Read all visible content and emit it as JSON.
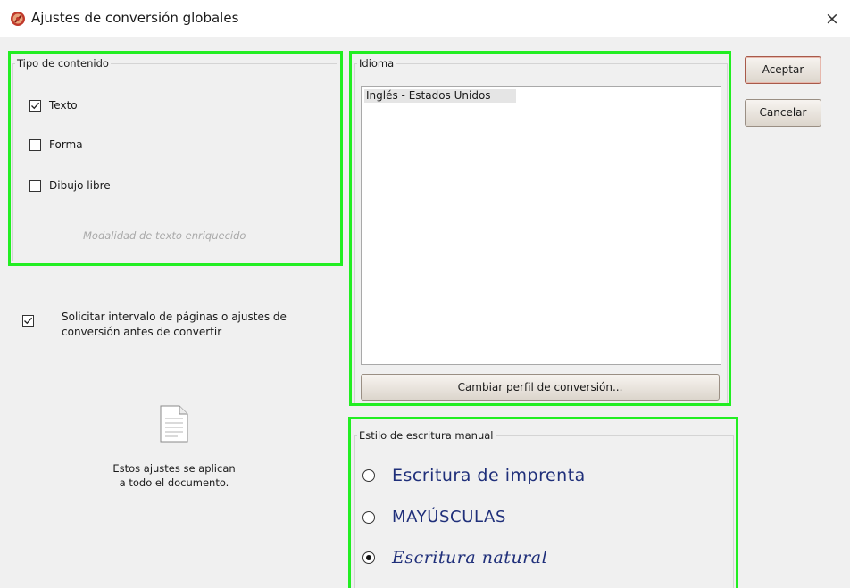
{
  "window": {
    "title": "Ajustes de conversión globales",
    "close_symbol": "×"
  },
  "content_type": {
    "legend": "Tipo de contenido",
    "options": [
      {
        "label": "Texto",
        "checked": true
      },
      {
        "label": "Forma",
        "checked": false
      },
      {
        "label": "Dibujo libre",
        "checked": false
      }
    ],
    "rich_text_hint": "Modalidad de texto enriquecido"
  },
  "page_range": {
    "checked": true,
    "line1": "Solicitar intervalo de páginas o ajustes de",
    "line2": "conversión antes de convertir"
  },
  "language": {
    "legend": "Idioma",
    "items": [
      "Inglés - Estados Unidos"
    ],
    "change_profile_label": "Cambiar perfil de conversión..."
  },
  "handwriting": {
    "legend": "Estilo de escritura manual",
    "options": [
      {
        "label": "Escritura de imprenta",
        "selected": false
      },
      {
        "label": "MAYÚSCULAS",
        "selected": false
      },
      {
        "label": "Escritura natural",
        "selected": true
      }
    ]
  },
  "buttons": {
    "ok": "Aceptar",
    "cancel": "Cancelar"
  },
  "note": {
    "line1": "Estos ajustes se aplican",
    "line2": "a todo el documento."
  },
  "colors": {
    "highlight": "#22ee22",
    "handwriting_ink": "#1f2f7a",
    "dialog_bg": "#f0f0f0"
  },
  "icons": {
    "app": "app-logo-icon",
    "close": "close-icon",
    "document": "document-icon"
  }
}
